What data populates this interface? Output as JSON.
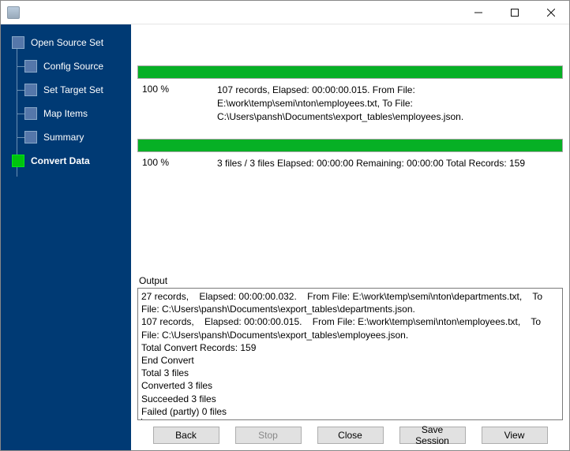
{
  "window": {
    "title": ""
  },
  "sidebar": {
    "items": [
      {
        "label": "Open Source Set",
        "level": 1,
        "active": false
      },
      {
        "label": "Config Source",
        "level": 2,
        "active": false
      },
      {
        "label": "Set Target Set",
        "level": 2,
        "active": false
      },
      {
        "label": "Map Items",
        "level": 2,
        "active": false
      },
      {
        "label": "Summary",
        "level": 2,
        "active": false
      },
      {
        "label": "Convert Data",
        "level": 1,
        "active": true
      }
    ]
  },
  "progress": {
    "file": {
      "percent": "100 %",
      "detail": "107 records,    Elapsed: 00:00:00.015.    From File: E:\\work\\temp\\semi\\nton\\employees.txt,    To File: C:\\Users\\pansh\\Documents\\export_tables\\employees.json."
    },
    "total": {
      "percent": "100 %",
      "detail": "3 files / 3 files    Elapsed: 00:00:00    Remaining: 00:00:00    Total Records: 159"
    }
  },
  "output": {
    "label": "Output",
    "text": "27 records,    Elapsed: 00:00:00.032.    From File: E:\\work\\temp\\semi\\nton\\departments.txt,    To File: C:\\Users\\pansh\\Documents\\export_tables\\departments.json.\n107 records,    Elapsed: 00:00:00.015.    From File: E:\\work\\temp\\semi\\nton\\employees.txt,    To File: C:\\Users\\pansh\\Documents\\export_tables\\employees.json.\nTotal Convert Records: 159\nEnd Convert\nTotal 3 files\nConverted 3 files\nSucceeded 3 files\nFailed (partly) 0 files"
  },
  "buttons": {
    "back": "Back",
    "stop": "Stop",
    "close": "Close",
    "save_session": "Save Session",
    "view": "View"
  }
}
